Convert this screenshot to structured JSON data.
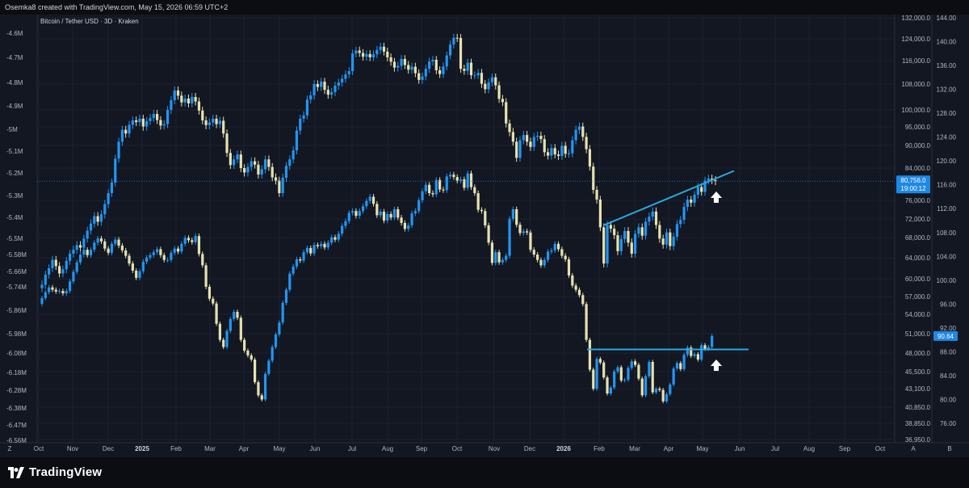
{
  "header": {
    "caption": "Osemka8 created with TradingView.com, May 15, 2026 06:59 UTC+2"
  },
  "footer": {
    "brand": "TradingView",
    "logo_icon": "tradingview-logo-icon"
  },
  "chart_data": {
    "type": "candlestick",
    "title": "Bitcoin / Tether USD · 3D · Kraken",
    "x_ticks": [
      "Oct",
      "Nov",
      "Dec",
      "2025",
      "Feb",
      "Mar",
      "Apr",
      "May",
      "Jun",
      "Jul",
      "Aug",
      "Sep",
      "Oct",
      "Nov",
      "Dec",
      "2026",
      "Feb",
      "Mar",
      "Apr",
      "May",
      "Jun",
      "Jul",
      "Aug",
      "Sep",
      "Oct"
    ],
    "left_axis": {
      "label": "Z",
      "ticks": [
        "-4.6M",
        "-4.7M",
        "-4.8M",
        "-4.9M",
        "-5M",
        "-5.1M",
        "-5.2M",
        "-5.3M",
        "-5.4M",
        "-5.5M",
        "-5.58M",
        "-5.66M",
        "-5.74M",
        "-5.86M",
        "-5.98M",
        "-6.08M",
        "-6.18M",
        "-6.28M",
        "-6.38M",
        "-6.47M",
        "-6.56M"
      ]
    },
    "price_axis": {
      "label": "A",
      "ticks": [
        "132,000.0",
        "124,000.0",
        "116,000.0",
        "108,000.0",
        "100,000.0",
        "95,000.0",
        "90,000.0",
        "84,000.0",
        "76,000.0",
        "72,000.0",
        "68,000.0",
        "64,000.0",
        "60,000.0",
        "57,000.0",
        "54,000.0",
        "51,000.0",
        "48,000.0",
        "45,500.0",
        "43,100.0",
        "40,850.0",
        "38,850.0",
        "36,950.0"
      ],
      "last_price": "80,756.0",
      "countdown": "19:00:12"
    },
    "right_axis": {
      "label": "B",
      "ticks": [
        "144.00",
        "140.00",
        "136.00",
        "132.00",
        "128.00",
        "124.00",
        "120.00",
        "116.00",
        "112.00",
        "108.00",
        "104.00",
        "100.00",
        "96.00",
        "92.00",
        "88.00",
        "84.00",
        "80.00",
        "76.00"
      ],
      "last_value": "90.64"
    },
    "upper_series": {
      "name": "Bitcoin / Tether USD",
      "closes": [
        59000,
        60800,
        62000,
        63600,
        62400,
        61000,
        61800,
        63400,
        64800,
        65600,
        66500,
        66000,
        67800,
        69500,
        71000,
        72600,
        71400,
        73000,
        75200,
        77800,
        80400,
        86500,
        91000,
        94200,
        93200,
        95600,
        96900,
        96400,
        97400,
        95100,
        96700,
        97600,
        98800,
        97000,
        95400,
        95800,
        100000,
        103000,
        106000,
        104400,
        102300,
        103500,
        102000,
        104000,
        102600,
        99800,
        96900,
        95500,
        96300,
        97400,
        95800,
        96800,
        93200,
        88000,
        84800,
        86300,
        87600,
        84000,
        82900,
        84300,
        85800,
        84900,
        82400,
        83700,
        86300,
        84300,
        81700,
        80900,
        77800,
        81600,
        84600,
        86300,
        88700,
        94000,
        97400,
        98400,
        103200,
        104500,
        108000,
        107100,
        108800,
        106200,
        104700,
        105500,
        107500,
        108500,
        109800,
        111300,
        112400,
        118600,
        119700,
        118800,
        117400,
        118400,
        117200,
        118300,
        119900,
        121100,
        119300,
        117200,
        115600,
        113600,
        114200,
        116600,
        114500,
        112900,
        113900,
        111700,
        109400,
        110600,
        113200,
        115700,
        116300,
        112700,
        111400,
        114000,
        117900,
        121900,
        124400,
        124300,
        113200,
        112500,
        115300,
        111000,
        111000,
        111800,
        108100,
        106400,
        108600,
        110300,
        107600,
        103400,
        102400,
        96000,
        93600,
        91000,
        86700,
        91400,
        92800,
        91000,
        89600,
        92300,
        92600,
        91700,
        88200,
        87300,
        89300,
        87600,
        87200,
        89900,
        87800,
        87900,
        91400,
        94200,
        95100,
        92300,
        89000,
        84400,
        78600,
        76200,
        70200,
        62900,
        70700,
        69900,
        68500,
        65300,
        67700,
        69400,
        67000,
        64800,
        68800,
        70200,
        68400,
        71400,
        72500,
        73600,
        70700,
        67800,
        66600,
        69100,
        66300,
        68200,
        70900,
        71800,
        74600,
        76200,
        75500,
        77400,
        79300,
        78100,
        80900,
        81400,
        81000,
        80756
      ],
      "trendline": "rising line drawn from about 70,600 (early Feb 2026) to about 83,300 (late May 2026)",
      "marker": "white up-arrow below latest candle"
    },
    "lower_series": {
      "scale": "right axis (B) and left axis (Z)",
      "closes": [
        97.0,
        98.0,
        98.8,
        98.4,
        98.1,
        98.2,
        97.8,
        98.2,
        99.8,
        101.4,
        103.0,
        104.3,
        105.1,
        104.2,
        105.1,
        106.3,
        107.0,
        106.5,
        105.3,
        104.6,
        106.1,
        106.8,
        105.8,
        105.0,
        104.1,
        102.8,
        101.6,
        100.4,
        101.5,
        103.1,
        103.8,
        104.2,
        104.7,
        105.2,
        104.2,
        103.4,
        103.4,
        104.6,
        105.3,
        104.8,
        106.1,
        107.1,
        106.7,
        106.4,
        107.4,
        104.4,
        102.5,
        98.9,
        96.9,
        96.1,
        92.7,
        90.0,
        88.8,
        91.5,
        93.5,
        94.7,
        93.7,
        90.0,
        88.2,
        87.4,
        86.7,
        82.9,
        80.7,
        80.0,
        84.3,
        86.5,
        88.8,
        90.9,
        92.9,
        96.2,
        98.4,
        101.1,
        102.3,
        103.5,
        103.3,
        104.7,
        105.4,
        104.5,
        105.9,
        105.7,
        106.1,
        105.5,
        106.3,
        107.2,
        106.8,
        107.8,
        109.1,
        109.9,
        111.3,
        111.6,
        110.8,
        111.6,
        112.4,
        113.3,
        114.0,
        112.8,
        110.9,
        111.5,
        110.0,
        111.1,
        110.5,
        111.9,
        110.5,
        109.6,
        108.6,
        109.2,
        111.2,
        111.6,
        113.4,
        114.9,
        116.0,
        114.6,
        114.4,
        116.8,
        115.2,
        115.1,
        117.4,
        117.7,
        117.3,
        116.7,
        116.9,
        115.5,
        117.9,
        115.6,
        114.6,
        111.8,
        111.6,
        109.2,
        106.3,
        102.9,
        104.7,
        103.0,
        103.4,
        104.1,
        110.3,
        111.9,
        109.3,
        107.9,
        108.2,
        108.0,
        105.1,
        104.3,
        103.4,
        102.5,
        103.4,
        104.8,
        105.0,
        106.1,
        105.2,
        104.1,
        103.5,
        100.8,
        99.1,
        98.4,
        97.5,
        96.0,
        90.0,
        85.0,
        81.8,
        86.8,
        86.2,
        83.7,
        81.0,
        82.0,
        84.7,
        85.4,
        83.2,
        83.3,
        85.3,
        86.4,
        85.8,
        83.5,
        80.7,
        83.9,
        86.3,
        81.2,
        81.8,
        81.6,
        79.7,
        80.9,
        82.5,
        85.2,
        86.1,
        85.1,
        87.5,
        88.7,
        87.3,
        87.6,
        86.7,
        89.1,
        88.5,
        88.8,
        90.64
      ],
      "horizontal_line": "flat resistance at about 88.4",
      "marker": "white up-arrow below latest candle"
    },
    "colors": {
      "background": "#131722",
      "up_candle": "#2196f3",
      "down_candle": "#e6e2b0",
      "line": "#29a8e0",
      "accent_label": "#1e88e5",
      "grid": "#1c2030",
      "axis_text": "#b2b5be"
    },
    "grid": true
  }
}
